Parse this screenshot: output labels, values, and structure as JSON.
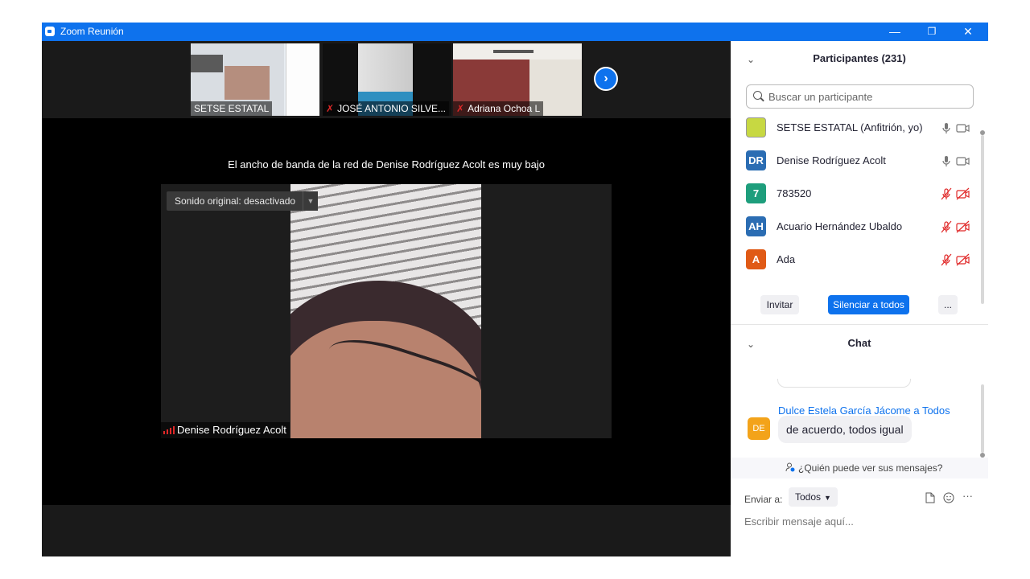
{
  "window": {
    "title": "Zoom Reunión",
    "controls": {
      "minimize": "—",
      "restore": "❐",
      "close": "✕"
    }
  },
  "video_strip": {
    "thumbnails": [
      {
        "name": "SETSE ESTATAL",
        "muted": false
      },
      {
        "name": "JOSÉ ANTONIO SILVE...",
        "muted": true
      },
      {
        "name": "Adriana Ochoa L",
        "muted": true
      }
    ],
    "next_icon": "chevron-right-icon"
  },
  "main_video": {
    "bandwidth_message": "El ancho de banda de la red de Denise Rodríguez Acolt es muy bajo",
    "original_sound": "Sonido original: desactivado",
    "speaker_name": "Denise Rodríguez Acolt"
  },
  "participants": {
    "title": "Participantes (231)",
    "search_placeholder": "Buscar un participante",
    "list": [
      {
        "initials": "",
        "name": "SETSE ESTATAL (Anfitrión, yo)",
        "color": "#c7d842",
        "muted": false
      },
      {
        "initials": "DR",
        "name": "Denise Rodríguez Acolt",
        "color": "#2b6db3",
        "muted": false
      },
      {
        "initials": "7",
        "name": "783520",
        "color": "#1e9e7c",
        "muted": true
      },
      {
        "initials": "AH",
        "name": "Acuario Hernández Ubaldo",
        "color": "#2b6db3",
        "muted": true
      },
      {
        "initials": "A",
        "name": "Ada",
        "color": "#e05a16",
        "muted": true
      }
    ],
    "invite_label": "Invitar",
    "mute_all_label": "Silenciar a todos",
    "more_label": "..."
  },
  "chat": {
    "title": "Chat",
    "sender": "Dulce Estela García Jácome a Todos",
    "sender_initials": "DE",
    "message": "de acuerdo, todos igual",
    "who_can_see": "¿Quién puede ver sus mensajes?",
    "send_to_label": "Enviar a:",
    "send_to_value": "Todos",
    "compose_placeholder": "Escribir mensaje aquí...",
    "more_label": "···"
  },
  "colors": {
    "accent": "#0e72ed",
    "muted_red": "#e02828"
  }
}
